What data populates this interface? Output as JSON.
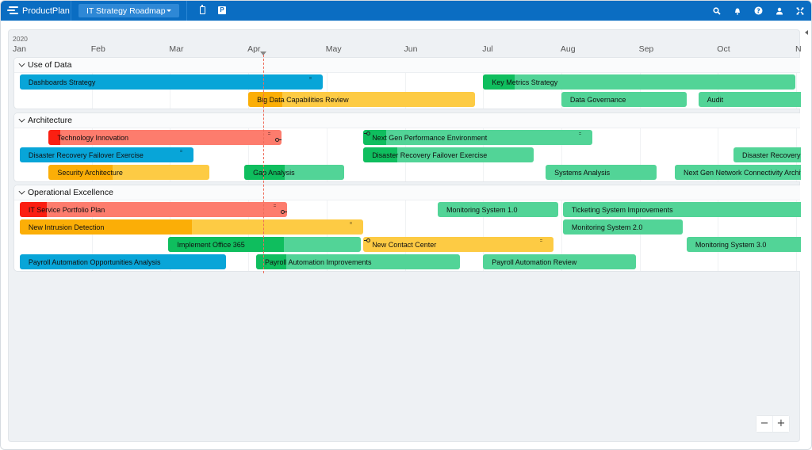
{
  "app": {
    "brand": "ProductPlan",
    "roadmap_name": "IT Strategy Roadmap",
    "toolbar_icons": [
      "clipboard-icon",
      "parking-lot-icon"
    ],
    "right_icons": [
      "search-icon",
      "bell-icon",
      "help-icon",
      "user-icon",
      "fullscreen-icon"
    ]
  },
  "timeline": {
    "year": "2020",
    "months": [
      "Jan",
      "Feb",
      "Mar",
      "Apr",
      "May",
      "Jun",
      "Jul",
      "Aug",
      "Sep",
      "Oct",
      "N"
    ],
    "today_marker_month_offset": 3.2
  },
  "colors": {
    "blue": "#08a5d8",
    "green": "#52d497",
    "green_progress": "#0fbe5e",
    "yellow": "#fdcb44",
    "yellow_progress": "#fbae07",
    "red": "#fd7c6d",
    "red_progress": "#fb1f12",
    "topbar": "#0a6dc2",
    "today_line": "#ee6b5a"
  },
  "lanes": [
    {
      "name": "Use of Data",
      "rows": [
        [
          {
            "label": "Dashboards Strategy",
            "color": "blue",
            "start": 0.08,
            "end": 3.95,
            "progress": 0,
            "grip": true
          },
          {
            "label": "Key Metrics Strategy",
            "color": "green",
            "start": 6.0,
            "end": 9.99,
            "progress": 0.1
          }
        ],
        [
          {
            "label": "Big Data Capabilities Review",
            "color": "yellow",
            "start": 3.0,
            "end": 5.9,
            "progress": 0.15
          },
          {
            "label": "Data Governance",
            "color": "green",
            "start": 7.0,
            "end": 8.6,
            "progress": 0
          },
          {
            "label": "Audit",
            "color": "green",
            "start": 8.75,
            "end": 10.1,
            "progress": 0
          }
        ]
      ]
    },
    {
      "name": "Architecture",
      "rows": [
        [
          {
            "label": "Technology Innovation",
            "color": "red",
            "start": 0.45,
            "end": 3.42,
            "progress": 0.05,
            "grip": true,
            "dep_end": true
          },
          {
            "label": "Next Gen Performance Environment",
            "color": "green",
            "start": 4.47,
            "end": 7.4,
            "progress": 0.1,
            "dep_start": true,
            "grip": true
          }
        ],
        [
          {
            "label": "Disaster Recovery Failover Exercise",
            "color": "blue",
            "start": 0.08,
            "end": 2.3,
            "progress": 0,
            "grip": true
          },
          {
            "label": "Disaster Recovery Failover Exercise",
            "color": "green",
            "start": 4.47,
            "end": 6.65,
            "progress": 0.2
          },
          {
            "label": "Disaster Recovery",
            "color": "green",
            "start": 9.2,
            "end": 10.1,
            "progress": 0
          }
        ],
        [
          {
            "label": "Security Architecture",
            "color": "yellow",
            "start": 0.45,
            "end": 2.5,
            "progress": 0.4
          },
          {
            "label": "Gap Analysis",
            "color": "green",
            "start": 2.95,
            "end": 4.23,
            "progress": 0.4
          },
          {
            "label": "Systems Analysis",
            "color": "green",
            "start": 6.8,
            "end": 8.22,
            "progress": 0
          },
          {
            "label": "Next Gen Network Connectivity Architecture",
            "color": "green",
            "start": 8.45,
            "end": 10.1,
            "progress": 0
          }
        ]
      ]
    },
    {
      "name": "Operational Excellence",
      "rows": [
        [
          {
            "label": "IT Service Portfolio Plan",
            "color": "red",
            "start": 0.08,
            "end": 3.5,
            "progress": 0.1,
            "grip": true,
            "dep_end": true
          },
          {
            "label": "Monitoring System 1.0",
            "color": "green",
            "start": 5.42,
            "end": 6.96,
            "progress": 0
          },
          {
            "label": "Ticketing System Improvements",
            "color": "green",
            "start": 7.02,
            "end": 10.1,
            "progress": 0
          }
        ],
        [
          {
            "label": "New Intrusion Detection",
            "color": "yellow",
            "start": 0.08,
            "end": 4.47,
            "progress": 0.5,
            "grip": true
          },
          {
            "label": "Monitoring System 2.0",
            "color": "green",
            "start": 7.02,
            "end": 8.55,
            "progress": 0
          }
        ],
        [
          {
            "label": "Implement Office 365",
            "color": "green",
            "start": 1.98,
            "end": 4.44,
            "progress": 0.6
          },
          {
            "label": "New Contact Center",
            "color": "yellow",
            "start": 4.47,
            "end": 6.9,
            "progress": 0,
            "dep_start": true,
            "grip": true
          },
          {
            "label": "Monitoring System 3.0",
            "color": "green",
            "start": 8.6,
            "end": 10.1,
            "progress": 0
          }
        ],
        [
          {
            "label": "Payroll Automation Opportunities Analysis",
            "color": "blue",
            "start": 0.08,
            "end": 2.72,
            "progress": 0
          },
          {
            "label": "Payroll Automation Improvements",
            "color": "green",
            "start": 3.1,
            "end": 5.7,
            "progress": 0.15
          },
          {
            "label": "Payroll Automation Review",
            "color": "green",
            "start": 6.0,
            "end": 7.95,
            "progress": 0
          }
        ]
      ]
    }
  ],
  "zoom_controls": {
    "minus": "−",
    "plus": "+"
  }
}
